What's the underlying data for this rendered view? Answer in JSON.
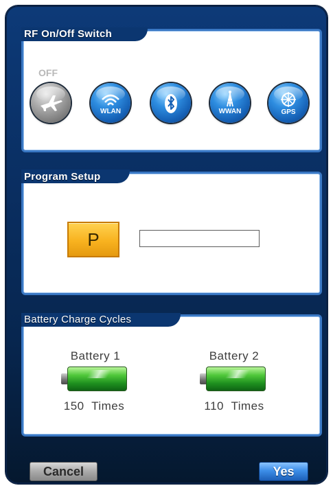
{
  "rf_section": {
    "title": "RF On/Off Switch",
    "off_label": "OFF",
    "icons": [
      {
        "name": "airplane-icon",
        "label": ""
      },
      {
        "name": "wlan-icon",
        "label": "WLAN"
      },
      {
        "name": "bluetooth-icon",
        "label": ""
      },
      {
        "name": "wwan-icon",
        "label": "WWAN"
      },
      {
        "name": "gps-icon",
        "label": "GPS"
      }
    ]
  },
  "program_section": {
    "title": "Program Setup",
    "p_button_label": "P",
    "input_value": ""
  },
  "battery_section": {
    "title": "Battery Charge Cycles",
    "batteries": [
      {
        "name": "Battery 1",
        "count": "150",
        "unit": "Times"
      },
      {
        "name": "Battery 2",
        "count": "110",
        "unit": "Times"
      }
    ]
  },
  "buttons": {
    "cancel": "Cancel",
    "yes": "Yes"
  },
  "colors": {
    "window_bg": "#0a2f63",
    "panel_border": "#3a78c4",
    "p_button": "#f8b21f",
    "battery_green": "#4ec739"
  }
}
